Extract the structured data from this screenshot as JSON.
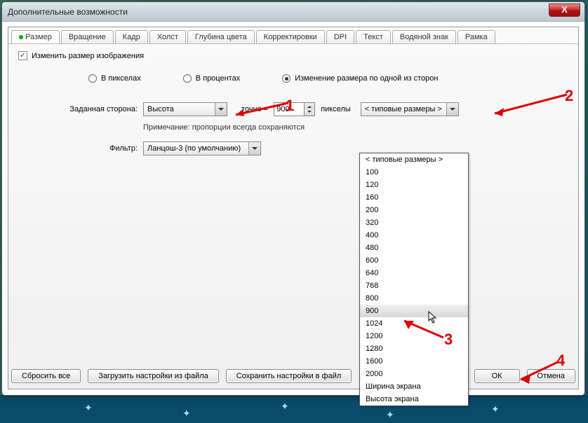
{
  "title": "Дополнительные возможности",
  "close_glyph": "X",
  "tabs": [
    "Размер",
    "Вращение",
    "Кадр",
    "Холст",
    "Глубина цвета",
    "Корректировки",
    "DPI",
    "Текст",
    "Водяной знак",
    "Рамка"
  ],
  "checkbox_label": "Изменить размер изображения",
  "radios": {
    "pixels": "В пикселах",
    "percent": "В процентах",
    "side": "Изменение размера по одной из сторон"
  },
  "row_side": {
    "label": "Заданная сторона:",
    "side_value": "Высота",
    "exact": "точно =",
    "num_value": "900",
    "unit": "пикселы",
    "preset_label": "< типовые размеры >"
  },
  "note": "Примечание: пропорции всегда сохраняются",
  "row_filter": {
    "label": "Фильтр:",
    "value": "Ланцош-3 (по умолчанию)"
  },
  "dropdown": [
    "< типовые размеры >",
    "100",
    "120",
    "160",
    "200",
    "320",
    "400",
    "480",
    "600",
    "640",
    "768",
    "800",
    "900",
    "1024",
    "1200",
    "1280",
    "1600",
    "2000",
    "Ширина экрана",
    "Высота экрана"
  ],
  "dropdown_hover": "900",
  "buttons": {
    "reset": "Сбросить все",
    "load": "Загрузить настройки из файла",
    "save": "Сохранить настройки в файл",
    "ok": "ОК",
    "cancel": "Отмена"
  },
  "markers": {
    "m1": "1",
    "m2": "2",
    "m3": "3",
    "m4": "4"
  }
}
